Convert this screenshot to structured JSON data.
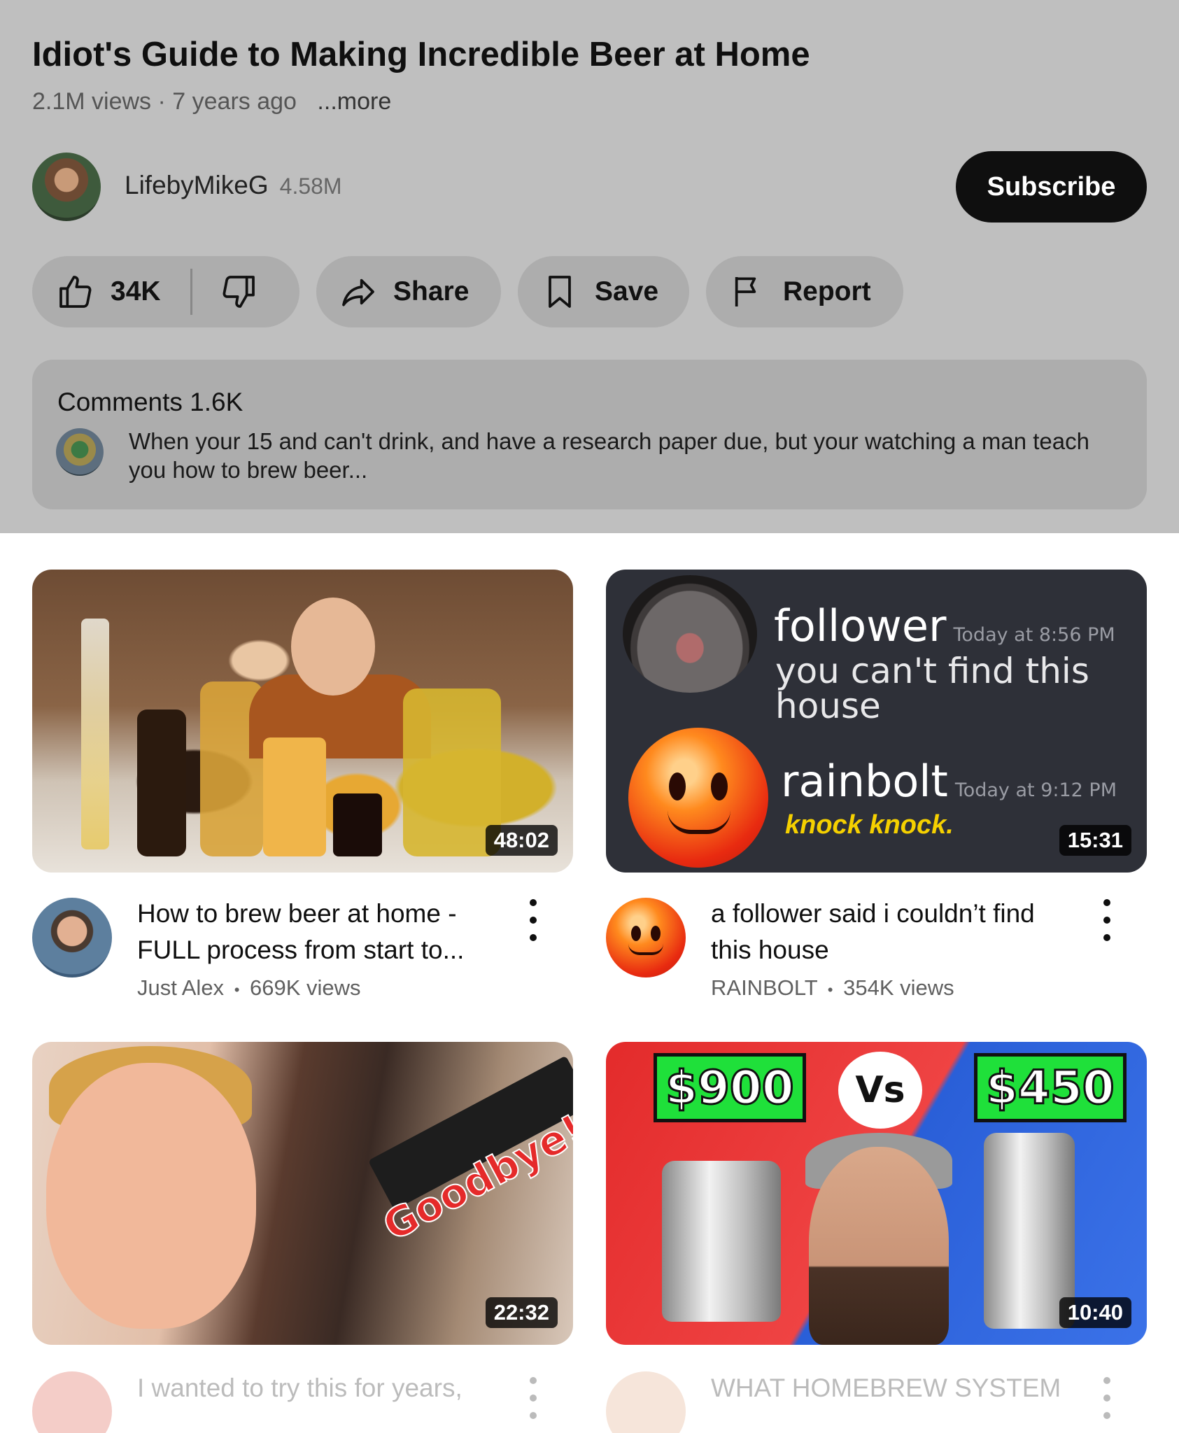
{
  "video": {
    "title": "Idiot's Guide to Making Incredible Beer at Home",
    "views": "2.1M views",
    "age": "7 years ago",
    "separator": "·",
    "more": "...more"
  },
  "channel": {
    "name": "LifebyMikeG",
    "subscribers": "4.58M",
    "subscribe_label": "Subscribe"
  },
  "actions": {
    "likes": "34K",
    "share": "Share",
    "save": "Save",
    "report": "Report"
  },
  "comments": {
    "title": "Comments 1.6K",
    "top_comment": "When your 15 and can't drink, and have a research paper due, but your watching a man teach you how to brew beer..."
  },
  "feed": [
    {
      "title": "How to brew beer at home - FULL process from start to...",
      "channel": "Just Alex",
      "views": "669K views",
      "duration": "48:02"
    },
    {
      "title": "a follower said i couldn’t find this house",
      "channel": "RAINBOLT",
      "views": "354K views",
      "duration": "15:31",
      "thumb_text": {
        "name1": "follower",
        "time1": "Today at 8:56 PM",
        "msg1": "you can't find this house",
        "name2": "rainbolt",
        "time2": "Today at 9:12 PM",
        "msg2": "knock knock."
      }
    },
    {
      "title": "I wanted to try this for years,",
      "duration": "22:32",
      "thumb_text": {
        "headline": "Goodbye!"
      }
    },
    {
      "title": "WHAT HOMEBREW SYSTEM",
      "duration": "10:40",
      "thumb_text": {
        "price_left": "$900",
        "vs": "Vs",
        "price_right": "$450"
      }
    }
  ],
  "meta_separator": "•",
  "colors": {
    "overlay": "#bfbfbf",
    "pill": "#adadad",
    "subscribe_bg": "#0f0f0f",
    "secondary_text": "#606060",
    "duration_bg": "#000000"
  },
  "icons": [
    "thumbs-up-icon",
    "thumbs-down-icon",
    "share-icon",
    "bookmark-icon",
    "flag-icon",
    "more-vert-icon"
  ]
}
